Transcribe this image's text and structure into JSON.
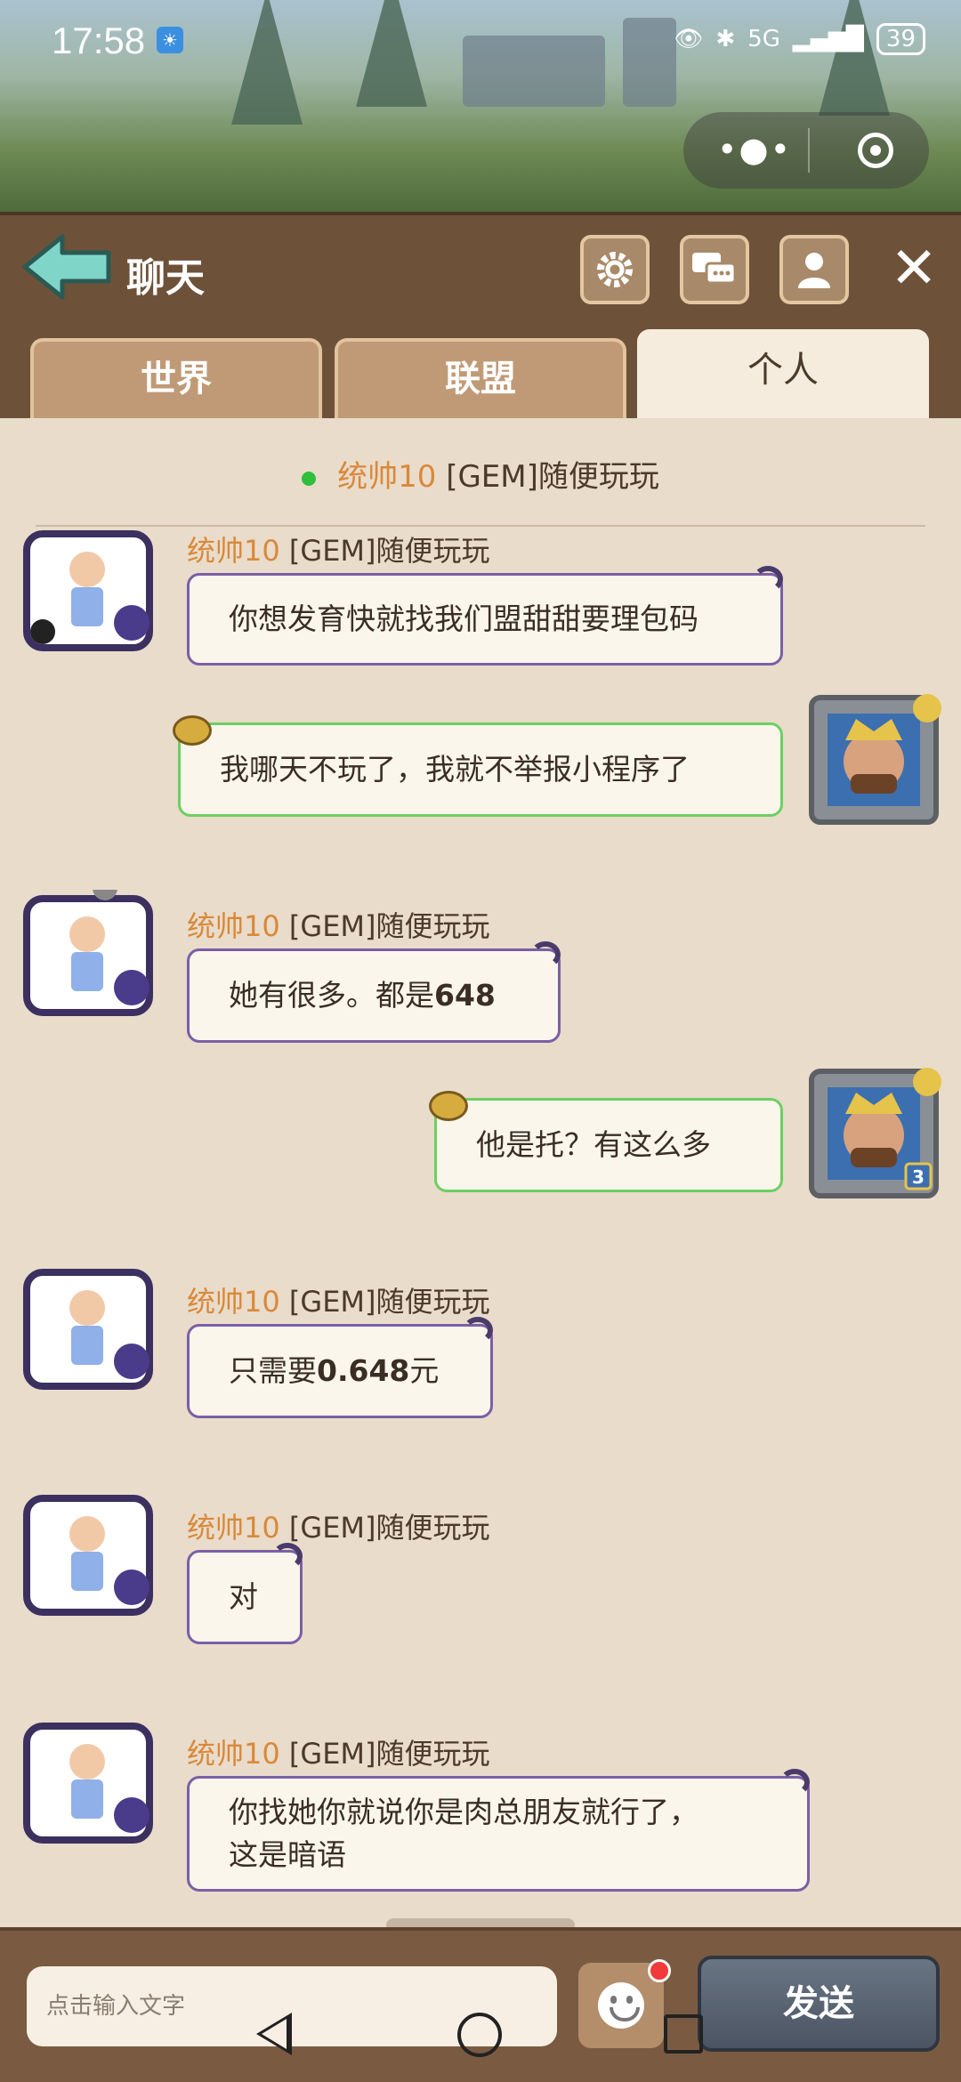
{
  "status_bar": {
    "time": "17:58",
    "network": "5G",
    "battery": "39"
  },
  "header": {
    "title": "聊天"
  },
  "tabs": [
    {
      "label": "世界"
    },
    {
      "label": "联盟"
    },
    {
      "label": "个人"
    }
  ],
  "chat": {
    "partner_name": "统帅10",
    "partner_alliance": "[GEM]随便玩玩",
    "messages": [
      {
        "sender_name": "统帅10",
        "sender_alliance": "[GEM]随便玩玩",
        "text": "你想发育快就找我们盟甜甜要理包码",
        "mine": false
      },
      {
        "text": "我哪天不玩了，我就不举报小程序了",
        "mine": true
      },
      {
        "sender_name": "统帅10",
        "sender_alliance": "[GEM]随便玩玩",
        "text_pre": "她有很多。都是",
        "text_bold": "648",
        "mine": false
      },
      {
        "text": "他是托？有这么多",
        "mine": true,
        "level": "3"
      },
      {
        "sender_name": "统帅10",
        "sender_alliance": "[GEM]随便玩玩",
        "text_pre": "只需要",
        "text_bold": "0.648",
        "text_post": "元",
        "mine": false
      },
      {
        "sender_name": "统帅10",
        "sender_alliance": "[GEM]随便玩玩",
        "text": "对",
        "mine": false
      },
      {
        "sender_name": "统帅10",
        "sender_alliance": "[GEM]随便玩玩",
        "text_line1": "你找她你就说你是肉总朋友就行了，",
        "text_line2": "这是暗语",
        "mine": false
      }
    ]
  },
  "input": {
    "placeholder": "点击输入文字",
    "send_label": "发送"
  },
  "colors": {
    "header_bg": "#6d5239",
    "chat_bg": "#e9dccb",
    "name_orange": "#d9893a",
    "partner_border": "#7b5fa6",
    "mine_border": "#6dcf62"
  }
}
